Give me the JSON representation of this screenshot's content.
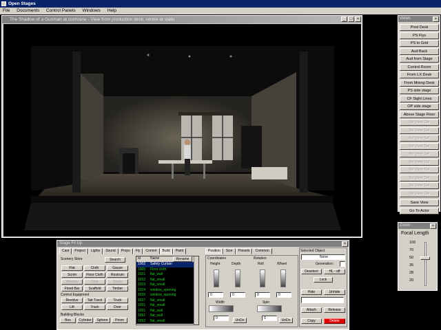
{
  "app": {
    "title": "Open Stages"
  },
  "menu": [
    "File",
    "Documents",
    "Control Panels",
    "Windows",
    "Help"
  ],
  "viewer": {
    "title": "The Shadow of a Gunman at cochrane - View from production desk, centre at stalls",
    "controls": [
      "_",
      "□",
      "×"
    ]
  },
  "views": {
    "title": "Views",
    "items": [
      {
        "label": "Prod Desk",
        "enabled": true
      },
      {
        "label": "PS Flys",
        "enabled": true
      },
      {
        "label": "PS to Grid",
        "enabled": true
      },
      {
        "label": "Aud Back",
        "enabled": true
      },
      {
        "label": "Aud from Stage",
        "enabled": true
      },
      {
        "label": "Control Room",
        "enabled": true
      },
      {
        "label": "From LX Desk",
        "enabled": true
      },
      {
        "label": "From Mixing Desk",
        "enabled": true
      },
      {
        "label": "PS side stage",
        "enabled": true
      },
      {
        "label": "CF Sight Lines",
        "enabled": true
      },
      {
        "label": "OP side stage",
        "enabled": true
      },
      {
        "label": "Above Stage Floor",
        "enabled": true
      },
      {
        "label": "No View Set",
        "enabled": false
      },
      {
        "label": "No View Set",
        "enabled": false
      },
      {
        "label": "No View Set",
        "enabled": false
      },
      {
        "label": "No View Set",
        "enabled": false
      },
      {
        "label": "No View Set",
        "enabled": false
      },
      {
        "label": "No View Set",
        "enabled": false
      },
      {
        "label": "No View Set",
        "enabled": false
      },
      {
        "label": "No View Set",
        "enabled": false
      },
      {
        "label": "No View Set",
        "enabled": false
      },
      {
        "label": "No View Set",
        "enabled": false
      },
      {
        "label": "Save View",
        "enabled": true
      },
      {
        "label": "Go To Actor",
        "enabled": true
      }
    ]
  },
  "zoom": {
    "title": "Zoom",
    "label": "Focal Length",
    "ticks": [
      "100",
      "70",
      "50",
      "35",
      "28",
      "20"
    ],
    "value": 50
  },
  "stagefit": {
    "title": "Stage Fit Up",
    "tabs": [
      "Cast",
      "Project",
      "Lights",
      "Sound",
      "Props",
      "Fly",
      "Control",
      "Build",
      "Paint"
    ],
    "right_tabs": [
      "Position",
      "Size",
      "Presets",
      "Common"
    ],
    "scenery_store": {
      "label": "Scenery Store",
      "search": "Search",
      "buttons": [
        [
          "Flat",
          "Cloth",
          "Gauze"
        ],
        [
          "Scrim",
          "Floor Cloth",
          "Rostrum"
        ],
        [
          "Window",
          "Door",
          "Stairs"
        ],
        [
          "Flood Bar",
          "Scaffold",
          "Timber"
        ]
      ]
    },
    "control_equipment": {
      "label": "Control Equipment",
      "buttons": [
        [
          "Revolve",
          "Tab Track",
          "Truck"
        ],
        [
          "Lift",
          "Track",
          "Door"
        ]
      ]
    },
    "building_blocks": {
      "label": "Building Blocks",
      "buttons": [
        "Box",
        "Cylinder",
        "Sphere",
        "Prism"
      ]
    },
    "table": {
      "columns": [
        "Id",
        "Name"
      ],
      "rename": "Rename",
      "rows": [
        {
          "id": "1002",
          "name": "Safety Curtain",
          "selected": true
        },
        {
          "id": "1005",
          "name": "Floor cloth"
        },
        {
          "id": "1021",
          "name": "flat_wall"
        },
        {
          "id": "1022",
          "name": "flat_small"
        },
        {
          "id": "1023",
          "name": "flat_small"
        },
        {
          "id": "1024",
          "name": "window_opening"
        },
        {
          "id": "1025",
          "name": "window_opening"
        },
        {
          "id": "1027",
          "name": "flat_small"
        },
        {
          "id": "1031",
          "name": "flat_small"
        },
        {
          "id": "1031",
          "name": "flat_wall"
        },
        {
          "id": "1051",
          "name": "flat_wall"
        },
        {
          "id": "1052",
          "name": "flat_small"
        }
      ]
    },
    "position": {
      "coordinates": "Coordinates",
      "height": "Height",
      "depth": "Depth",
      "width": "Width",
      "rotation": "Rotation",
      "roll": "Roll",
      "wheel": "Wheel",
      "spin": "Spin",
      "values": [
        "0",
        "0",
        "0",
        "0",
        "0",
        "0"
      ],
      "undo": "UnDo"
    },
    "selected_object": {
      "label": "Selected Object",
      "name": "None",
      "generation": "Generation:",
      "deselect": "Deselect",
      "hl_off": "HL - off",
      "lock": "Lock",
      "hide": "Hide",
      "unhide": "Unhide",
      "attach": "Attach",
      "release": "Release",
      "copy": "Copy",
      "delete": "Delete"
    }
  }
}
